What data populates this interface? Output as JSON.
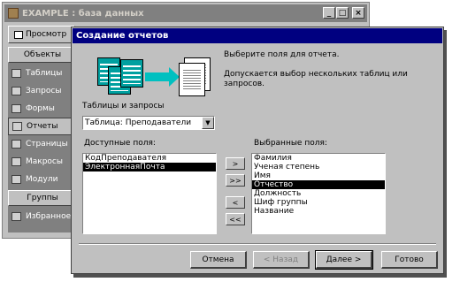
{
  "db_window": {
    "title": "EXAMPLE : база данных",
    "minimize": "_",
    "maximize": "□",
    "close": "×",
    "toolbar_preview": "Просмотр",
    "objects_header": "Объекты",
    "sidebar_items": [
      {
        "label": "Таблицы",
        "icon": "table-icon"
      },
      {
        "label": "Запросы",
        "icon": "query-icon"
      },
      {
        "label": "Формы",
        "icon": "form-icon"
      },
      {
        "label": "Отчеты",
        "icon": "report-icon"
      },
      {
        "label": "Страницы",
        "icon": "page-icon"
      },
      {
        "label": "Макросы",
        "icon": "macro-icon"
      },
      {
        "label": "Модули",
        "icon": "module-icon"
      }
    ],
    "groups_header": "Группы",
    "groups_items": [
      {
        "label": "Избранное",
        "icon": "favorites-icon"
      }
    ]
  },
  "dialog": {
    "title": "Создание отчетов",
    "instruction": "Выберите поля для отчета.",
    "hint": "Допускается выбор нескольких таблиц или запросов.",
    "tables_label": "Таблицы и запросы",
    "tables_value": "Таблица: Преподаватели",
    "available_label": "Доступные поля:",
    "available_fields": [
      "КодПреподавателя",
      "ЭлектроннаяПочта"
    ],
    "available_selected": 1,
    "selected_label": "Выбранные поля:",
    "selected_fields": [
      "Фамилия",
      "Ученая степень",
      "Имя",
      "Отчество",
      "Должность",
      "Шиф группы",
      "Название"
    ],
    "selected_selected": 3,
    "move_buttons": [
      ">",
      ">>",
      "<",
      "<<"
    ],
    "buttons": {
      "cancel": "Отмена",
      "back": "< Назад",
      "next": "Далее >",
      "finish": "Готово"
    }
  }
}
